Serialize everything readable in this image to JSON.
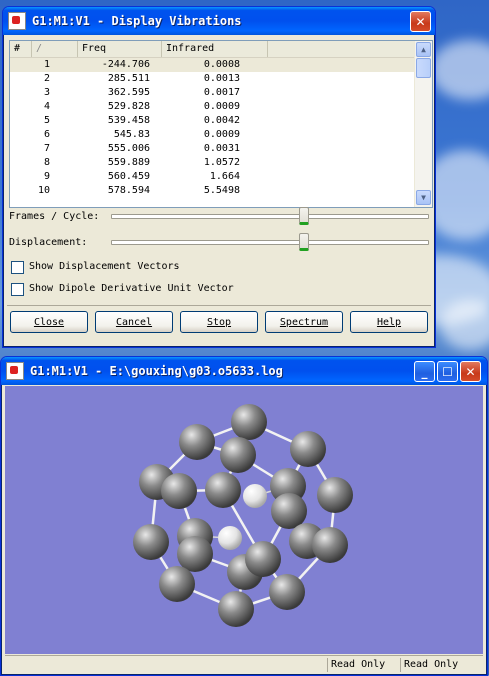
{
  "dialog": {
    "title": "G1:M1:V1 - Display Vibrations",
    "columns": {
      "index": "#",
      "sort": "/",
      "freq": "Freq",
      "infrared": "Infrared"
    },
    "rows": [
      {
        "index": "1",
        "freq": "-244.706",
        "infrared": "0.0008"
      },
      {
        "index": "2",
        "freq": "285.511",
        "infrared": "0.0013"
      },
      {
        "index": "3",
        "freq": "362.595",
        "infrared": "0.0017"
      },
      {
        "index": "4",
        "freq": "529.828",
        "infrared": "0.0009"
      },
      {
        "index": "5",
        "freq": "539.458",
        "infrared": "0.0042"
      },
      {
        "index": "6",
        "freq": "545.83",
        "infrared": "0.0009"
      },
      {
        "index": "7",
        "freq": "555.006",
        "infrared": "0.0031"
      },
      {
        "index": "8",
        "freq": "559.889",
        "infrared": "1.0572"
      },
      {
        "index": "9",
        "freq": "560.459",
        "infrared": "1.664"
      },
      {
        "index": "10",
        "freq": "578.594",
        "infrared": "5.5498"
      }
    ],
    "frames_label": "Frames / Cycle:",
    "displacement_label": "Displacement:",
    "frames_level": 0.61,
    "displacement_level": 0.61,
    "show_vectors_label": "Show Displacement Vectors",
    "show_vectors_checked": false,
    "show_dipole_label": "Show Dipole Derivative Unit Vector",
    "show_dipole_checked": false,
    "buttons": {
      "close": "Close",
      "cancel": "Cancel",
      "stop": "Stop",
      "spectrum": "Spectrum",
      "help": "Help"
    }
  },
  "viewer": {
    "title": "G1:M1:V1 - E:\\gouxing\\g03.o5633.log",
    "status": [
      "Read Only",
      "Read Only"
    ],
    "background_color": "#8080d2"
  }
}
